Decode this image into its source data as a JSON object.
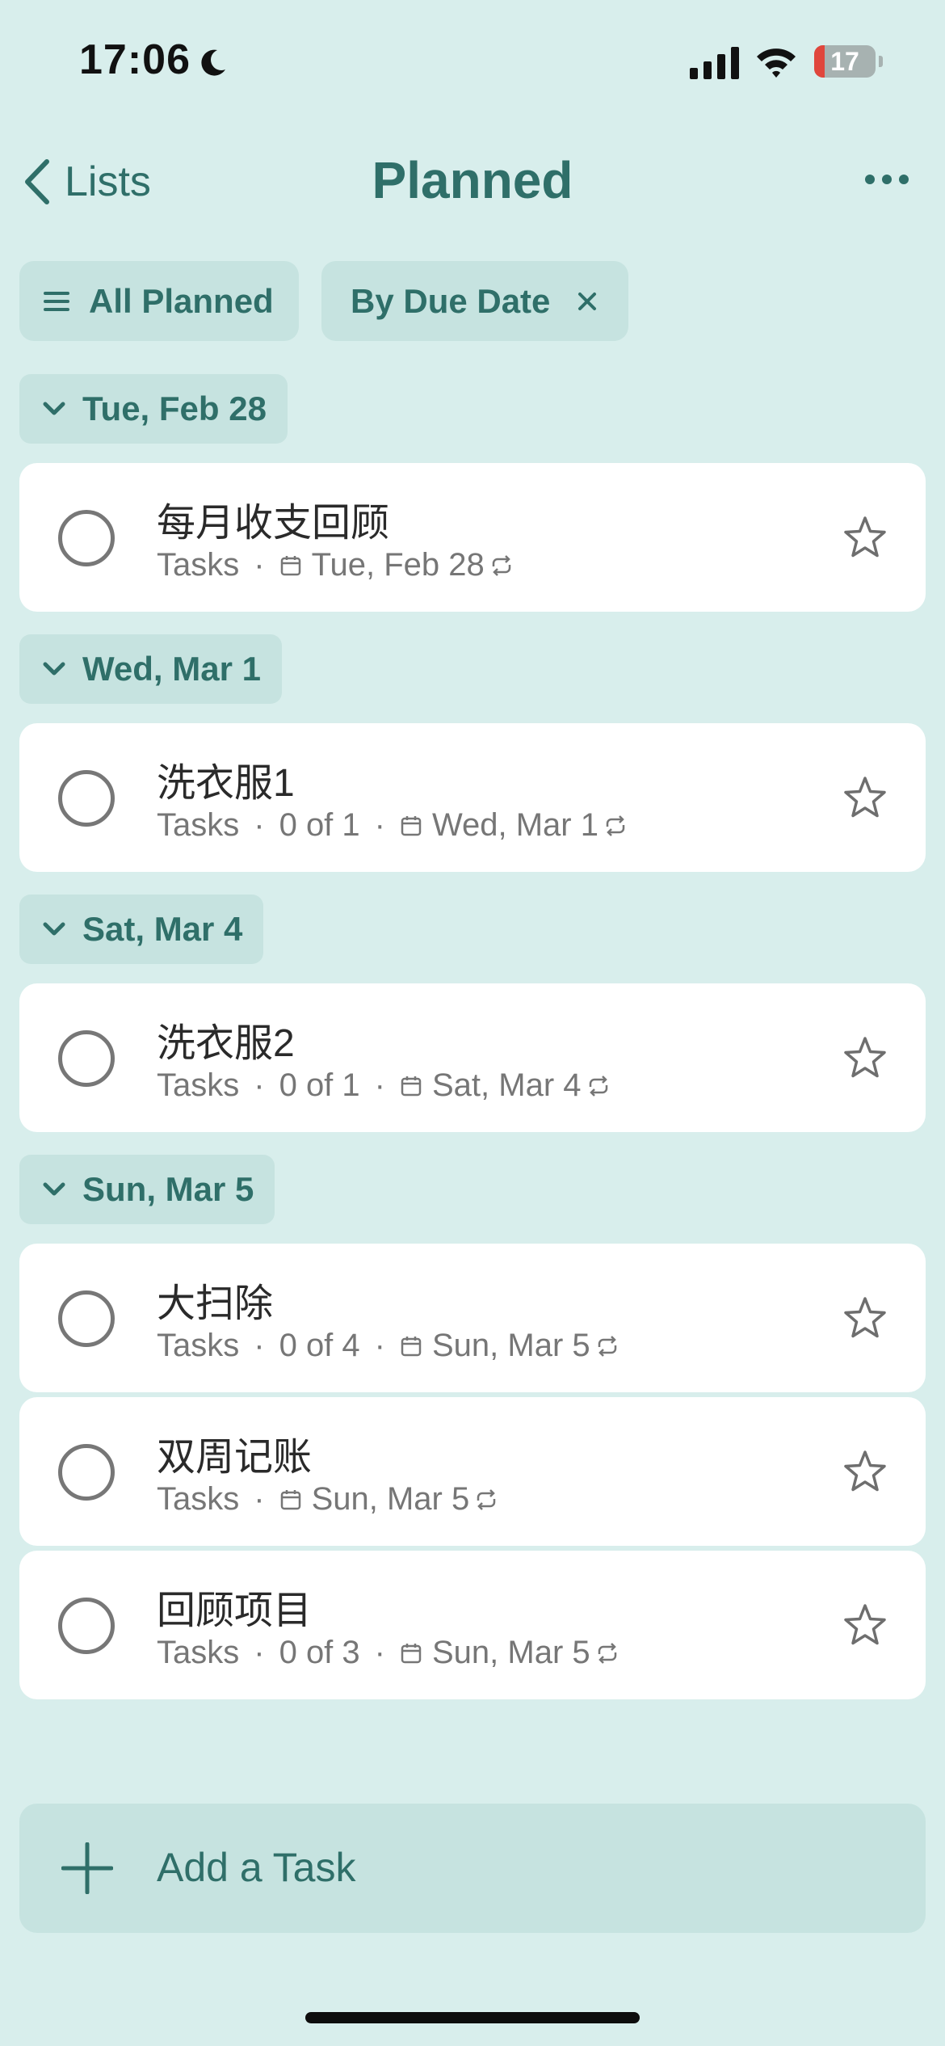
{
  "status_bar": {
    "time": "17:06",
    "battery": "17",
    "battery_level": 0.17
  },
  "nav": {
    "back_label": "Lists",
    "title": "Planned",
    "more_icon": "more-horizontal-icon"
  },
  "filters": {
    "all_label": "All Planned",
    "sort_label": "By Due Date"
  },
  "groups": [
    {
      "label": "Tue, Feb 28"
    },
    {
      "label": "Wed, Mar 1"
    },
    {
      "label": "Sat, Mar 4"
    },
    {
      "label": "Sun, Mar 5"
    }
  ],
  "tasks": [
    {
      "title": "每月收支回顾",
      "list": "Tasks",
      "progress": "",
      "due": "Tue, Feb 28",
      "repeat": true,
      "starred": false
    },
    {
      "title": "洗衣服1",
      "list": "Tasks",
      "progress": "0 of 1",
      "due": "Wed, Mar 1",
      "repeat": true,
      "starred": false
    },
    {
      "title": "洗衣服2",
      "list": "Tasks",
      "progress": "0 of 1",
      "due": "Sat, Mar 4",
      "repeat": true,
      "starred": false
    },
    {
      "title": "大扫除",
      "list": "Tasks",
      "progress": "0 of 4",
      "due": "Sun, Mar 5",
      "repeat": true,
      "starred": false
    },
    {
      "title": "双周记账",
      "list": "Tasks",
      "progress": "",
      "due": "Sun, Mar 5",
      "repeat": true,
      "starred": false
    },
    {
      "title": "回顾项目",
      "list": "Tasks",
      "progress": "0 of 3",
      "due": "Sun, Mar 5",
      "repeat": true,
      "starred": false
    }
  ],
  "add_task": {
    "label": "Add a Task"
  },
  "colors": {
    "background": "#d8eeec",
    "accent": "#2f6f69",
    "chip_background": "#c6e3e0",
    "card_background": "#ffffff",
    "battery_low": "#e0463c"
  }
}
